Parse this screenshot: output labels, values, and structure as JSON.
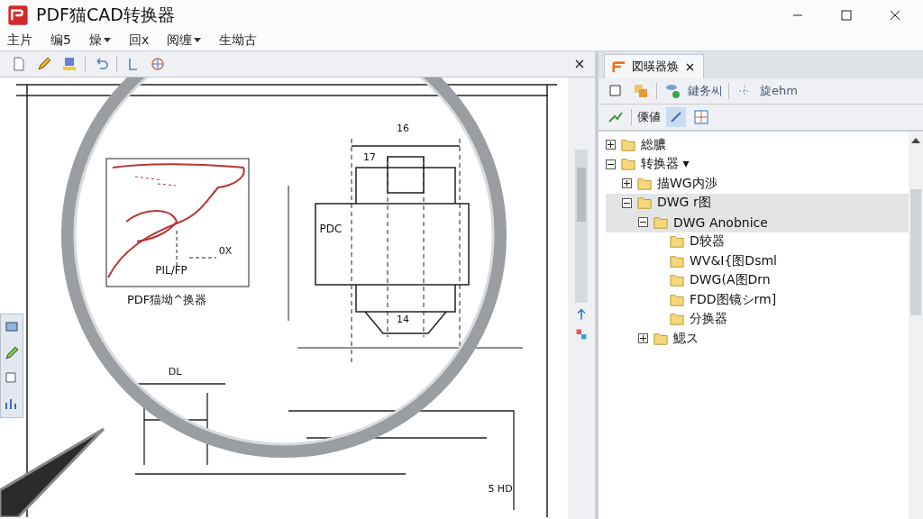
{
  "window": {
    "title": "PDF猫CAD转换器"
  },
  "menu": [
    {
      "label": "主片",
      "has_menu": false
    },
    {
      "label": "编5",
      "has_menu": false
    },
    {
      "label": "燥",
      "has_menu": true
    },
    {
      "label": "回x",
      "has_menu": false
    },
    {
      "label": "阅缠",
      "has_menu": true
    },
    {
      "label": "生坳古",
      "has_menu": false
    }
  ],
  "document": {
    "drawing_labels": [
      "16",
      "17",
      "PDC",
      "PIL/FP",
      "0X",
      "PDF猫坳^换器",
      "14",
      "DL",
      "5 HD"
    ]
  },
  "panel": {
    "tab": "図暎器焕",
    "toolbar_texts": [
      "鍵务씨",
      "旋ehm"
    ],
    "toolbar2_text": "傈値",
    "tree": [
      {
        "label": "総膿",
        "expanded": false,
        "selected": false
      },
      {
        "label": "转换器 ▾",
        "expanded": true,
        "selected": false,
        "children": [
          {
            "label": "描WG内渉",
            "expanded": false,
            "selected": false
          },
          {
            "label": "DWG r图",
            "expanded": true,
            "selected": true,
            "children": [
              {
                "label": "DWG Anobnice",
                "expanded": true,
                "selected": true,
                "children": [
                  {
                    "label": "D较器",
                    "selected": false
                  },
                  {
                    "label": "WV&I{图Dsml",
                    "selected": false
                  },
                  {
                    "label": "DWG(A图Drn",
                    "selected": false
                  },
                  {
                    "label": "FDD图镜シrm]",
                    "selected": false
                  },
                  {
                    "label": "分换器",
                    "selected": false
                  }
                ]
              },
              {
                "label": "鰓ス",
                "expanded": false,
                "selected": false
              }
            ]
          }
        ]
      }
    ]
  }
}
